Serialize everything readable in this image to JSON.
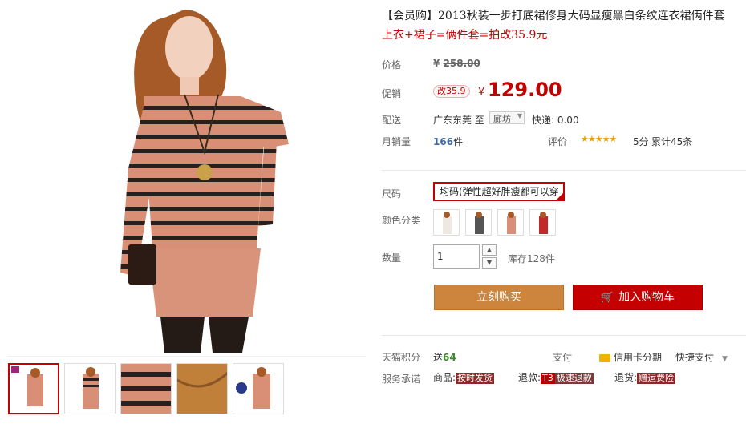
{
  "product": {
    "title": "【会员购】2013秋装一步打底裙修身大码显瘦黑白条纹连衣裙俩件套",
    "subtitle": "上衣+裙子=俩件套=拍改35.9元"
  },
  "price": {
    "label": "价格",
    "currency": "¥",
    "original": "258.00"
  },
  "promo": {
    "label": "促销",
    "tag": "改35.9",
    "currency": "¥",
    "price": "129.00"
  },
  "shipping": {
    "label": "配送",
    "from": "广东东莞",
    "to_word": "至",
    "to_city": "廊坊",
    "fee": "快递: 0.00"
  },
  "sales": {
    "label": "月销量",
    "count": "166",
    "unit": "件",
    "rating_label": "评价",
    "stars": "★★★★★",
    "score": "5分",
    "review_count": "累计45条"
  },
  "size": {
    "label": "尺码",
    "value": "均码(弹性超好胖瘦都可以穿"
  },
  "color": {
    "label": "颜色分类",
    "options": [
      "white",
      "gray",
      "pink",
      "red"
    ]
  },
  "quantity": {
    "label": "数量",
    "value": "1",
    "stock": "库存128件"
  },
  "buttons": {
    "buy": "立刻购买",
    "cart": "加入购物车"
  },
  "bottom": {
    "points_label": "天猫积分",
    "points_prefix": "送",
    "points": "64",
    "pay_label": "支付",
    "pay_method": "信用卡分期",
    "quick_pay": "快捷支付",
    "service_label": "服务承诺",
    "goods_label": "商品:",
    "goods_tag": "按时发货",
    "refund_label": "退款:",
    "refund_tag_prefix": "T3",
    "refund_tag": "极速退款",
    "return_label": "退货:",
    "return_tag": "赠运费险"
  },
  "colors": {
    "accent": "#c40000",
    "buy_button": "#cd843c",
    "stripe_pink": "#d98f75",
    "stripe_dark": "#2a1e1e"
  }
}
